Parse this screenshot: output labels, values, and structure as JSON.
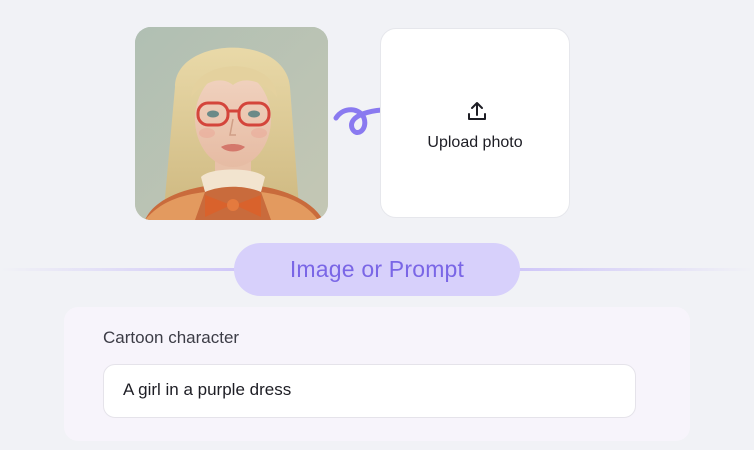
{
  "sample_photo": {
    "subject": "portrait-photo",
    "icon": "portrait-image"
  },
  "arrow": {
    "icon": "curly-arrow-right-icon",
    "color": "#8a7af0"
  },
  "upload": {
    "icon": "upload-icon",
    "label": "Upload photo"
  },
  "mode_pill": {
    "label": "Image or Prompt",
    "accent": "#7a66e6",
    "background": "#d7d0fb"
  },
  "prompt": {
    "label": "Cartoon character",
    "value": "A girl in a purple dress"
  }
}
